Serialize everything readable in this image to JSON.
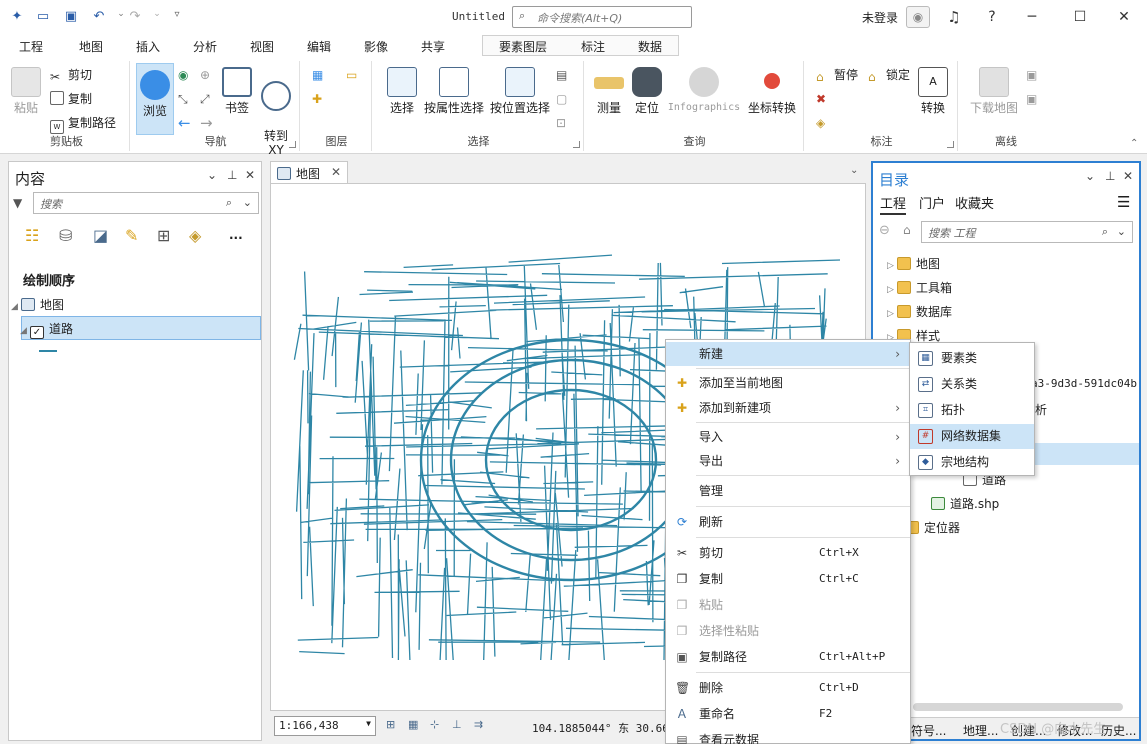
{
  "window": {
    "title": "Untitled",
    "command_search_placeholder": "命令搜索(Alt+Q)",
    "user": "未登录",
    "help": "?",
    "minimize": "─",
    "maximize": "☐",
    "close": "✕"
  },
  "menu_tabs": [
    "工程",
    "地图",
    "插入",
    "分析",
    "视图",
    "编辑",
    "影像",
    "共享"
  ],
  "active_tab": "地图",
  "context_tabs": [
    "要素图层",
    "标注",
    "数据"
  ],
  "ribbon": {
    "clipboard": {
      "label": "剪贴板",
      "paste": "粘贴",
      "cut": "剪切",
      "copy": "复制",
      "copy_path": "复制路径"
    },
    "navigate": {
      "label": "导航",
      "explore": "浏览",
      "bookmarks": "书签",
      "goto_xy": "转到\nXY"
    },
    "layer": {
      "label": "图层"
    },
    "selection": {
      "label": "选择",
      "select": "选择",
      "select_by_attributes": "按属性选择",
      "select_by_location": "按位置选择"
    },
    "inquiry": {
      "label": "查询",
      "measure": "测量",
      "locate": "定位",
      "infographics": "Infographics",
      "convert_coords": "坐标转换"
    },
    "labeling": {
      "label": "标注",
      "pause": "暂停",
      "lock": "锁定",
      "convert": "转换"
    },
    "offline": {
      "label": "离线",
      "download_map": "下载地图"
    }
  },
  "contents_pane": {
    "title": "内容",
    "search_placeholder": "搜索",
    "more": "...",
    "drawing_order": "绘制顺序",
    "map_item": "地图",
    "layer_item": "道路"
  },
  "map_view": {
    "tab_label": "地图",
    "scale": "1:166,438",
    "coordinates": "104.1885044° 东  30.664"
  },
  "catalog_pane": {
    "title": "目录",
    "tabs": [
      "工程",
      "门户",
      "收藏夹"
    ],
    "search_placeholder": "搜索 工程",
    "tree": [
      "地图",
      "工具箱",
      "数据库",
      "样式"
    ],
    "partial_gdb_text": "a3-9d3d-591dc04b",
    "partial_analysis_text": "析",
    "road_fc": "道路",
    "road_shp": "道路.shp",
    "locators": "定位器",
    "bottom_tabs": [
      "符号...",
      "地理...",
      "创建...",
      "修改...",
      "历史..."
    ]
  },
  "context_menu": [
    {
      "label": "新建",
      "shortcut": "",
      "submenu": true,
      "disabled": false,
      "highlight": true
    },
    {
      "label": "添加至当前地图",
      "shortcut": "",
      "submenu": false,
      "disabled": false
    },
    {
      "label": "添加到新建项",
      "shortcut": "",
      "submenu": true,
      "disabled": false
    },
    {
      "label": "导入",
      "shortcut": "",
      "submenu": true,
      "disabled": false
    },
    {
      "label": "导出",
      "shortcut": "",
      "submenu": true,
      "disabled": false
    },
    {
      "label": "管理",
      "shortcut": "",
      "submenu": false,
      "disabled": false
    },
    {
      "label": "刷新",
      "shortcut": "",
      "submenu": false,
      "disabled": false
    },
    {
      "label": "剪切",
      "shortcut": "Ctrl+X",
      "submenu": false,
      "disabled": false
    },
    {
      "label": "复制",
      "shortcut": "Ctrl+C",
      "submenu": false,
      "disabled": false
    },
    {
      "label": "粘贴",
      "shortcut": "",
      "submenu": false,
      "disabled": true
    },
    {
      "label": "选择性粘贴",
      "shortcut": "",
      "submenu": false,
      "disabled": true
    },
    {
      "label": "复制路径",
      "shortcut": "Ctrl+Alt+P",
      "submenu": false,
      "disabled": false
    },
    {
      "label": "删除",
      "shortcut": "Ctrl+D",
      "submenu": false,
      "disabled": false
    },
    {
      "label": "重命名",
      "shortcut": "F2",
      "submenu": false,
      "disabled": false
    },
    {
      "label": "查看元数据",
      "shortcut": "",
      "submenu": false,
      "disabled": false
    }
  ],
  "new_submenu": [
    "要素类",
    "关系类",
    "拓扑",
    "网络数据集",
    "宗地结构"
  ],
  "new_submenu_highlight": "网络数据集",
  "watermark": "CSDN @向水先生",
  "colors": {
    "accent": "#2d7fd2",
    "road": "#2e86a6",
    "highlight": "#cce4f7"
  }
}
